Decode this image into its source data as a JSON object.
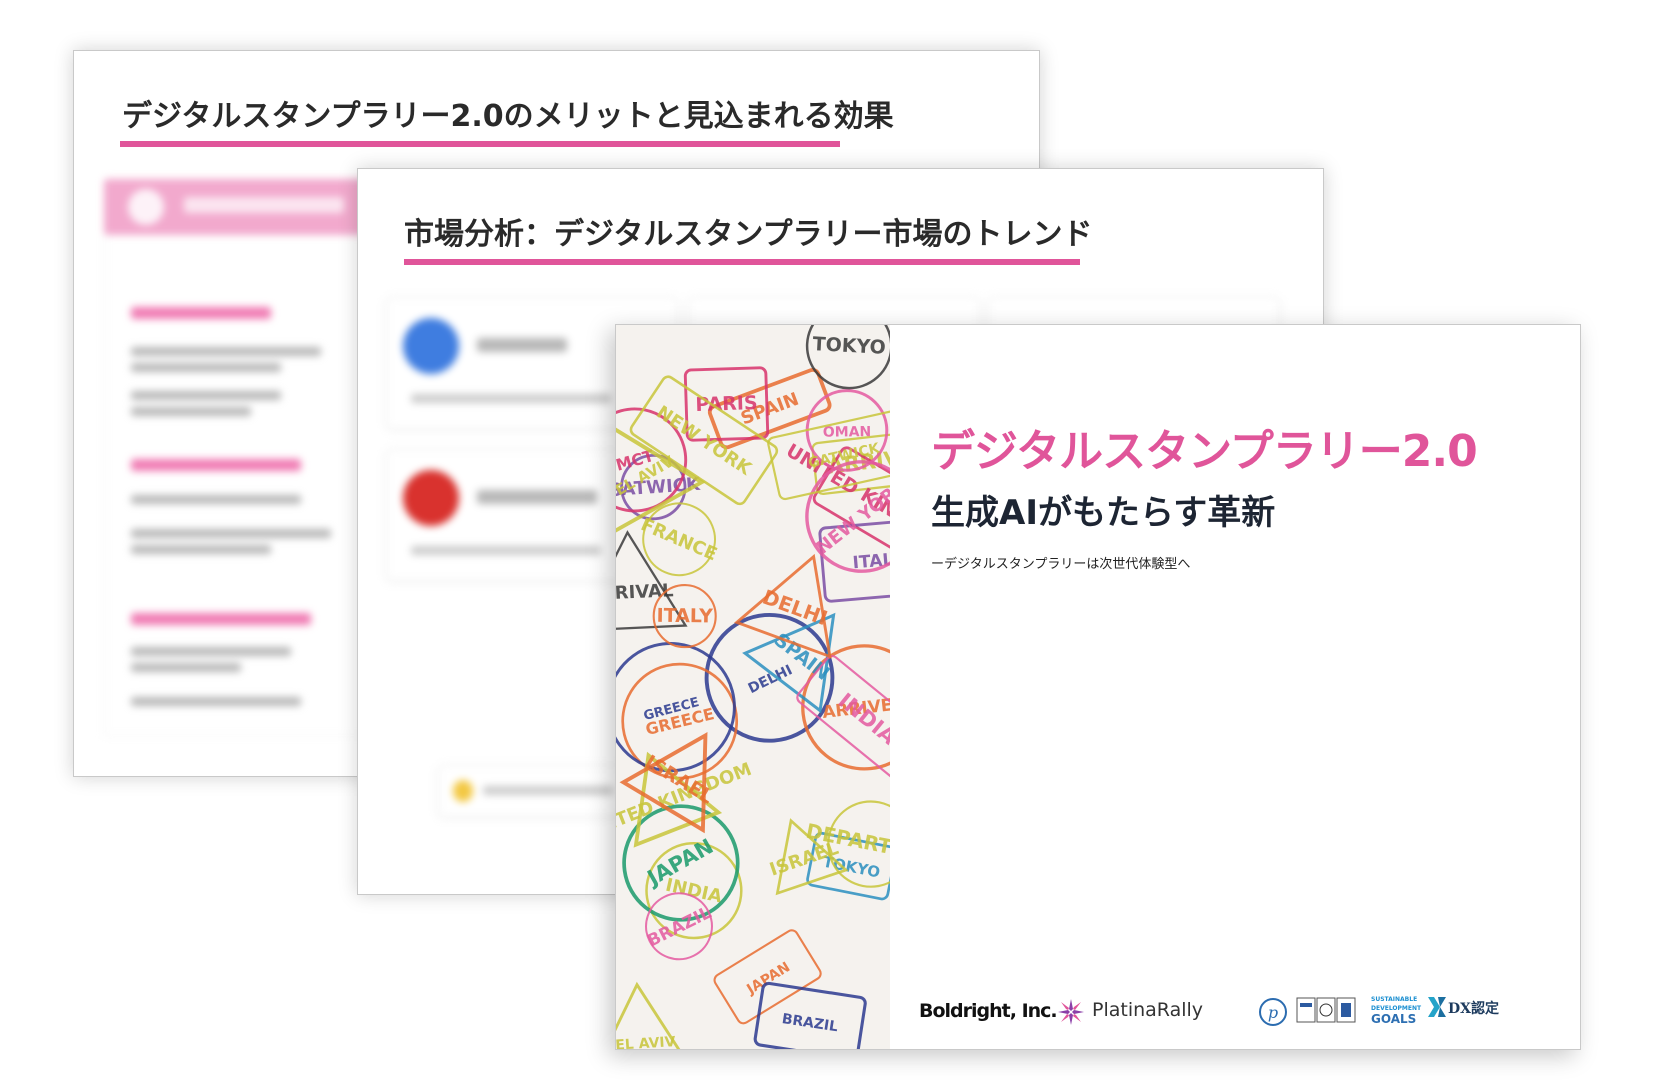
{
  "slides": {
    "back": {
      "title": "デジタルスタンプラリー2.0のメリットと見込まれる効果"
    },
    "middle": {
      "title": "市場分析：デジタルスタンプラリー市場のトレンド"
    },
    "front": {
      "title": "デジタルスタンプラリー2.0",
      "subtitle": "生成AIがもたらす革新",
      "tagline": "ーデジタルスタンプラリーは次世代体験型へ",
      "company": "Boldright, Inc.",
      "brand": "PlatinaRally",
      "sdgs_line1": "SUSTAINABLE",
      "sdgs_line2": "DEVELOPMENT",
      "sdgs_line3": "GOALS",
      "dx_label": "DX認定",
      "stamp_words": [
        "SPAIN",
        "INDIA",
        "DELHI",
        "ARRIVAL",
        "GREECE",
        "UNITED KINGDOM",
        "GATWICK",
        "ITALY",
        "JAPAN",
        "TOKYO",
        "ISRAEL",
        "TEL AVIV",
        "NEW YORK",
        "BRAZIL",
        "OMAN",
        "FRANCE",
        "PARIS",
        "DEPARTURE",
        "MCT",
        "ARRIVED"
      ]
    }
  },
  "colors": {
    "accent_pink": "#e0559a",
    "title_dark": "#1d2533"
  }
}
